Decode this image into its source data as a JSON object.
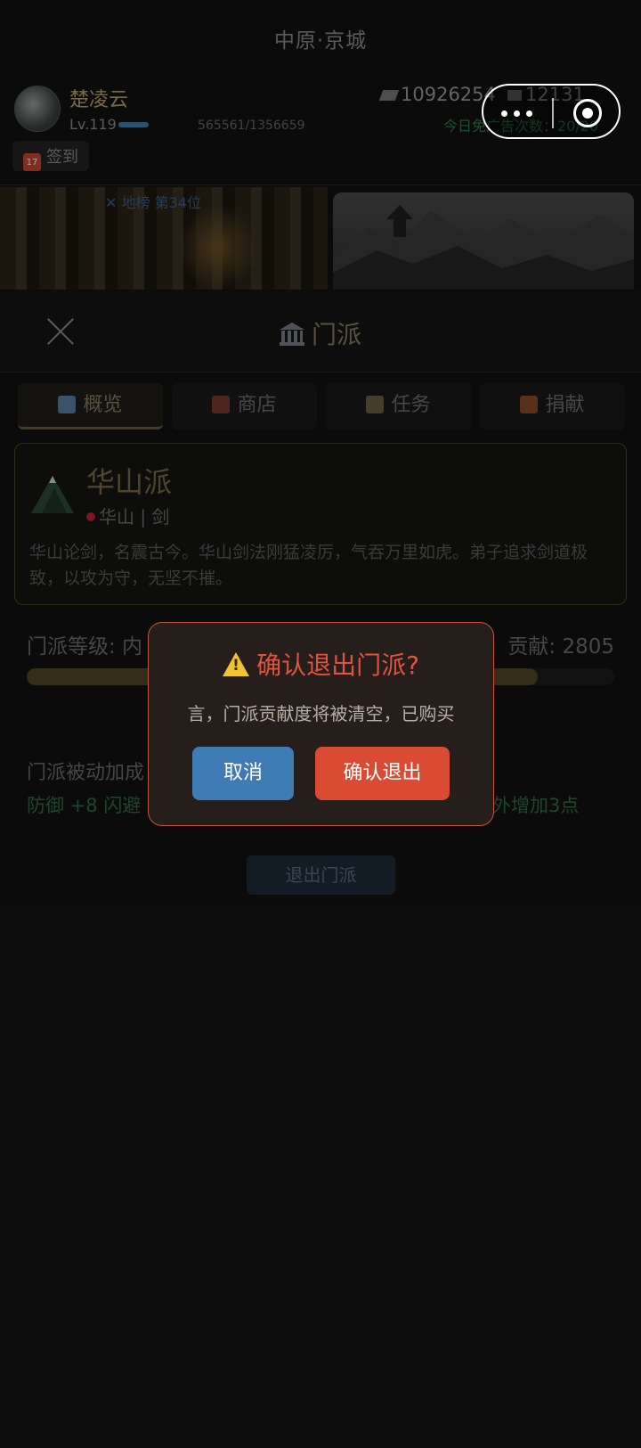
{
  "topbar": {
    "title": "中原·京城"
  },
  "player": {
    "name": "楚凌云",
    "level": "Lv.119",
    "exp": "565561/1356659",
    "money": "10926254",
    "money2": "12131",
    "daily": "今日免广告次数：20/20",
    "sign_label": "签到",
    "sign_icon": "calendar-icon",
    "level_progress": 0.42
  },
  "banner": {
    "rank": "✕ 地榜 第34位"
  },
  "panel": {
    "title": "门派",
    "icon": "temple-icon"
  },
  "tabs": [
    {
      "label": "概览",
      "icon": "chart-icon",
      "color": "#5b7fa8"
    },
    {
      "label": "商店",
      "icon": "calendar-icon",
      "color": "#c44a3a"
    },
    {
      "label": "任务",
      "icon": "clipboard-icon",
      "color": "#8a7a5a"
    },
    {
      "label": "捐献",
      "icon": "gift-icon",
      "color": "#c0542f"
    }
  ],
  "sect": {
    "name": "华山派",
    "location": "华山 | 剑",
    "description": "华山论剑，名震古今。华山剑法刚猛凌厉，气吞万里如虎。弟子追求剑道极致，以攻为守，无坚不摧。"
  },
  "level": {
    "label": "门派等级: 内",
    "contribution": "贡献: 2805",
    "progress": 0.87
  },
  "passive": {
    "title": "门派被动加成",
    "bonus_left": "防御 +8  闪避",
    "bonus_right": "外增加3点"
  },
  "leave_button": "退出门派",
  "dialog": {
    "title": "确认退出门派?",
    "message": "言，门派贡献度将被清空，已购买",
    "cancel": "取消",
    "confirm": "确认退出"
  },
  "colors": {
    "accent": "#8a7c62",
    "danger": "#d94c33",
    "primary": "#3f7bb5"
  }
}
